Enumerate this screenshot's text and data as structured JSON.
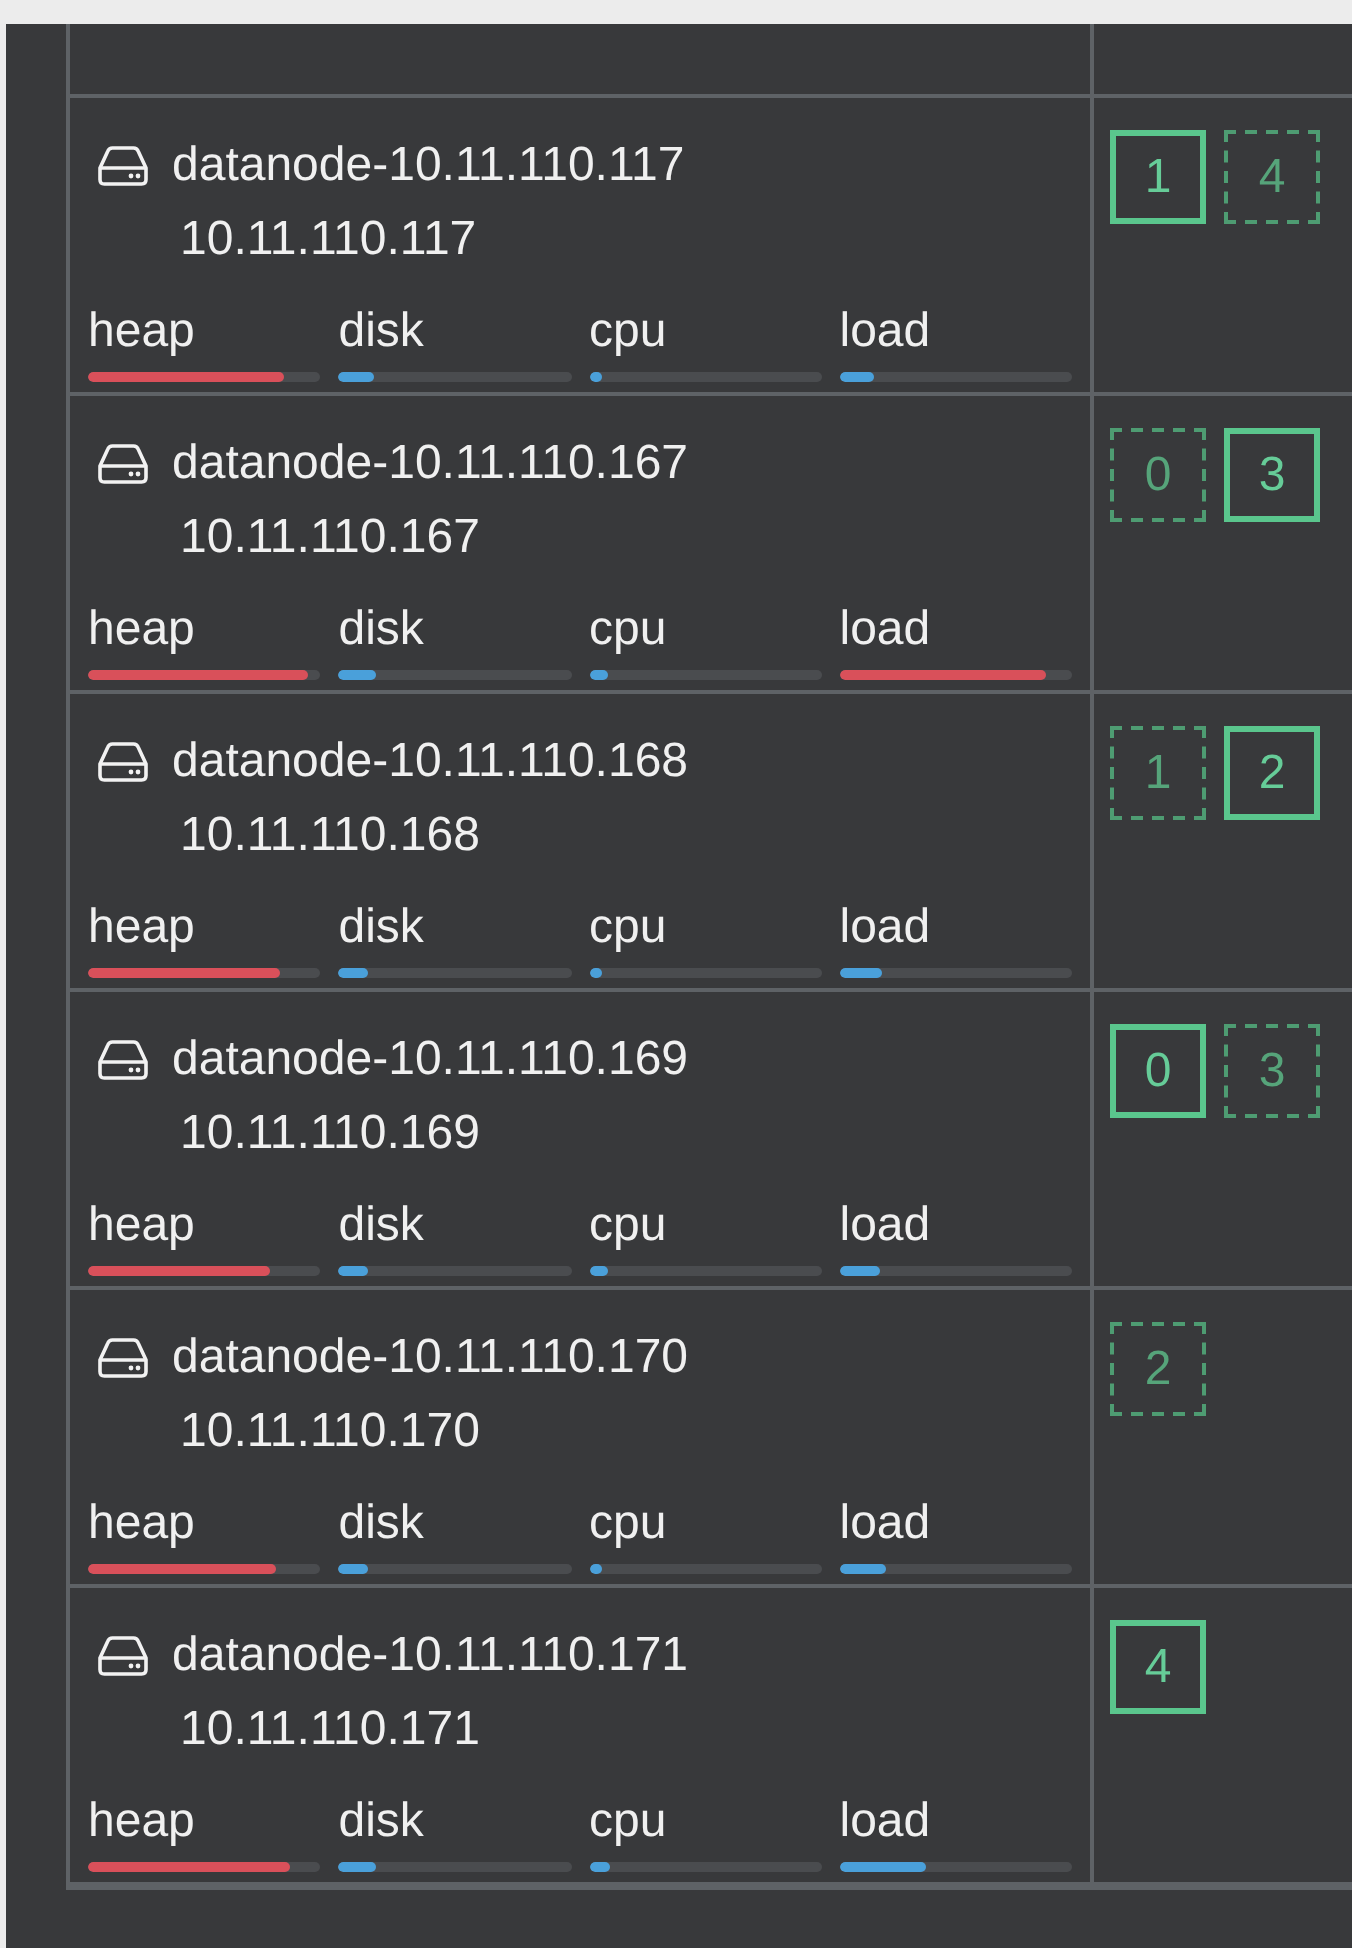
{
  "nodes": [
    {
      "name": "datanode-10.11.110.117",
      "address": "10.11.110.117",
      "metrics": [
        {
          "label": "heap",
          "level": 0.84
        },
        {
          "label": "disk",
          "level": 0.15
        },
        {
          "label": "cpu",
          "level": 0.06
        },
        {
          "label": "load",
          "level": 0.15
        }
      ],
      "shards": [
        {
          "label": "1",
          "primary": true
        },
        {
          "label": "4",
          "primary": false
        }
      ]
    },
    {
      "name": "datanode-10.11.110.167",
      "address": "10.11.110.167",
      "metrics": [
        {
          "label": "heap",
          "level": 0.95
        },
        {
          "label": "disk",
          "level": 0.16
        },
        {
          "label": "cpu",
          "level": 0.08
        },
        {
          "label": "load",
          "level": 0.89
        }
      ],
      "shards": [
        {
          "label": "0",
          "primary": false
        },
        {
          "label": "3",
          "primary": true
        }
      ]
    },
    {
      "name": "datanode-10.11.110.168",
      "address": "10.11.110.168",
      "metrics": [
        {
          "label": "heap",
          "level": 0.83
        },
        {
          "label": "disk",
          "level": 0.13
        },
        {
          "label": "cpu",
          "level": 0.06
        },
        {
          "label": "load",
          "level": 0.18
        }
      ],
      "shards": [
        {
          "label": "1",
          "primary": false
        },
        {
          "label": "2",
          "primary": true
        }
      ]
    },
    {
      "name": "datanode-10.11.110.169",
      "address": "10.11.110.169",
      "metrics": [
        {
          "label": "heap",
          "level": 0.78
        },
        {
          "label": "disk",
          "level": 0.13
        },
        {
          "label": "cpu",
          "level": 0.08
        },
        {
          "label": "load",
          "level": 0.17
        }
      ],
      "shards": [
        {
          "label": "0",
          "primary": true
        },
        {
          "label": "3",
          "primary": false
        }
      ]
    },
    {
      "name": "datanode-10.11.110.170",
      "address": "10.11.110.170",
      "metrics": [
        {
          "label": "heap",
          "level": 0.81
        },
        {
          "label": "disk",
          "level": 0.13
        },
        {
          "label": "cpu",
          "level": 0.06
        },
        {
          "label": "load",
          "level": 0.2
        }
      ],
      "shards": [
        {
          "label": "2",
          "primary": false
        }
      ]
    },
    {
      "name": "datanode-10.11.110.171",
      "address": "10.11.110.171",
      "metrics": [
        {
          "label": "heap",
          "level": 0.87
        },
        {
          "label": "disk",
          "level": 0.16
        },
        {
          "label": "cpu",
          "level": 0.09
        },
        {
          "label": "load",
          "level": 0.37
        }
      ],
      "shards": [
        {
          "label": "4",
          "primary": true
        }
      ]
    }
  ]
}
